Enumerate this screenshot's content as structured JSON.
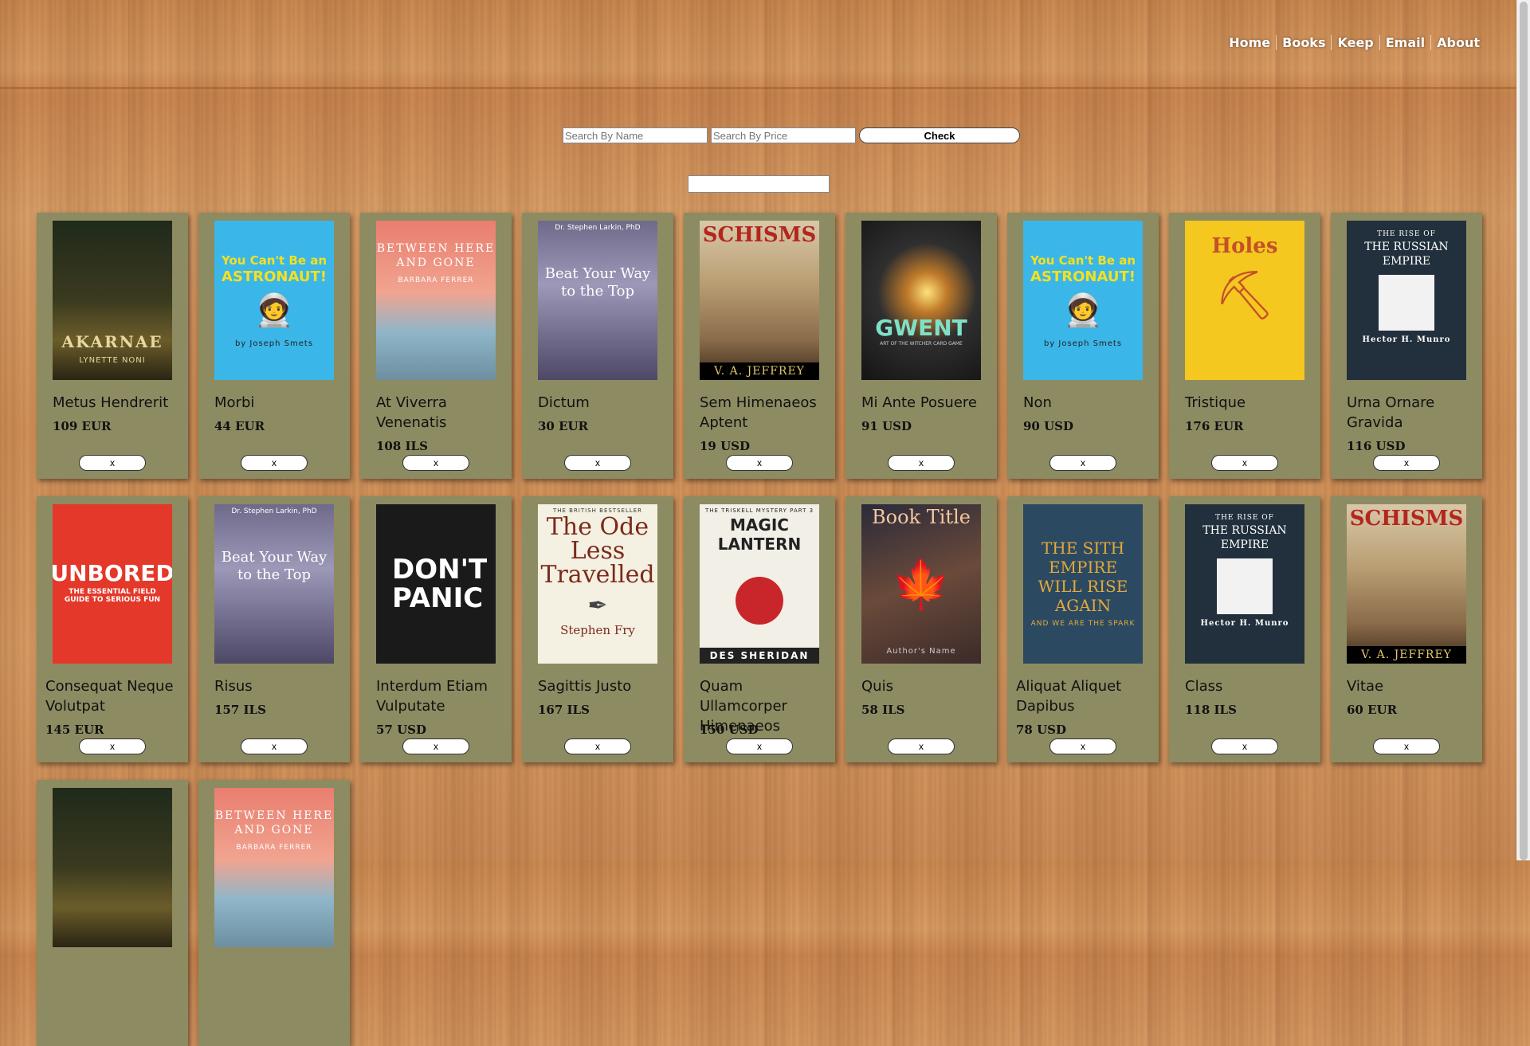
{
  "nav": [
    "Home",
    "Books",
    "Keep",
    "Email",
    "About"
  ],
  "search": {
    "name_placeholder": "Search By Name",
    "price_placeholder": "Search By Price",
    "check_label": "Check"
  },
  "remove_label": "x",
  "books": [
    {
      "title": "Metus Hendrerit",
      "price": "109 EUR",
      "cover": {
        "top": "",
        "main": "AKARNAE",
        "bottom": "LYNETTE NONI"
      }
    },
    {
      "title": "Morbi",
      "price": "44 EUR",
      "cover": {
        "top": "You Can't Be an",
        "main": "ASTRONAUT!",
        "bottom": "by Joseph Smets"
      }
    },
    {
      "title": "At Viverra Venenatis",
      "price": "108 ILS",
      "cover": {
        "top": "BETWEEN HERE AND GONE",
        "main": "",
        "bottom": "BARBARA FERRER"
      }
    },
    {
      "title": "Dictum",
      "price": "30 EUR",
      "cover": {
        "top": "Dr. Stephen Larkin, PhD",
        "main": "Beat Your Way to the Top",
        "bottom": ""
      }
    },
    {
      "title": "Sem Himenaeos Aptent",
      "price": "19 USD",
      "cover": {
        "top": "",
        "main": "SCHISMS",
        "bottom": "V. A. JEFFREY"
      }
    },
    {
      "title": "Mi Ante Posuere",
      "price": "91 USD",
      "cover": {
        "top": "",
        "main": "GWENT",
        "bottom": "ART OF THE WITCHER CARD GAME"
      }
    },
    {
      "title": "Non",
      "price": "90 USD",
      "cover": {
        "top": "You Can't Be an",
        "main": "ASTRONAUT!",
        "bottom": "by Joseph Smets"
      }
    },
    {
      "title": "Tristique",
      "price": "176 EUR",
      "cover": {
        "top": "",
        "main": "Holes",
        "bottom": ""
      }
    },
    {
      "title": "Urna Ornare Gravida",
      "price": "116 USD",
      "cover": {
        "top": "THE RISE OF",
        "main": "THE RUSSIAN EMPIRE",
        "bottom": "Hector H. Munro"
      }
    },
    {
      "title": "Consequat Neque Volutpat",
      "price": "145 EUR",
      "cover": {
        "top": "",
        "main": "UNBORED",
        "bottom": "THE ESSENTIAL FIELD GUIDE TO SERIOUS FUN"
      }
    },
    {
      "title": "Risus",
      "price": "157 ILS",
      "cover": {
        "top": "Dr. Stephen Larkin, PhD",
        "main": "Beat Your Way to the Top",
        "bottom": ""
      }
    },
    {
      "title": "Interdum Etiam Vulputate",
      "price": "57 USD",
      "cover": {
        "top": "",
        "main": "DON'T PANIC",
        "bottom": ""
      }
    },
    {
      "title": "Sagittis Justo",
      "price": "167 ILS",
      "cover": {
        "top": "THE BRITISH BESTSELLER",
        "main": "The Ode Less Travelled",
        "bottom": "Stephen Fry"
      }
    },
    {
      "title": "Quam Ullamcorper Himenaeos",
      "price": "150 USD",
      "cover": {
        "top": "THE TRISKELL MYSTERY PART 3",
        "main": "MAGIC LANTERN",
        "bottom": "DES SHERIDAN"
      }
    },
    {
      "title": "Quis",
      "price": "58 ILS",
      "cover": {
        "top": "",
        "main": "Book Title",
        "bottom": "Author's Name"
      }
    },
    {
      "title": "Aliquat Aliquet Dapibus",
      "price": "78 USD",
      "cover": {
        "top": "THE SITH EMPIRE",
        "main": "WILL RISE AGAIN",
        "bottom": "AND WE ARE THE SPARK"
      }
    },
    {
      "title": "Class",
      "price": "118 ILS",
      "cover": {
        "top": "THE RISE OF",
        "main": "THE RUSSIAN EMPIRE",
        "bottom": "Hector H. Munro"
      }
    },
    {
      "title": "Vitae",
      "price": "60 EUR",
      "cover": {
        "top": "",
        "main": "SCHISMS",
        "bottom": "V. A. JEFFREY"
      }
    },
    {
      "title": "",
      "price": "",
      "cover": {
        "top": "",
        "main": "",
        "bottom": ""
      }
    },
    {
      "title": "",
      "price": "",
      "cover": {
        "top": "BETWEEN HERE AND GONE",
        "main": "",
        "bottom": "BARBARA FERRER"
      }
    }
  ]
}
